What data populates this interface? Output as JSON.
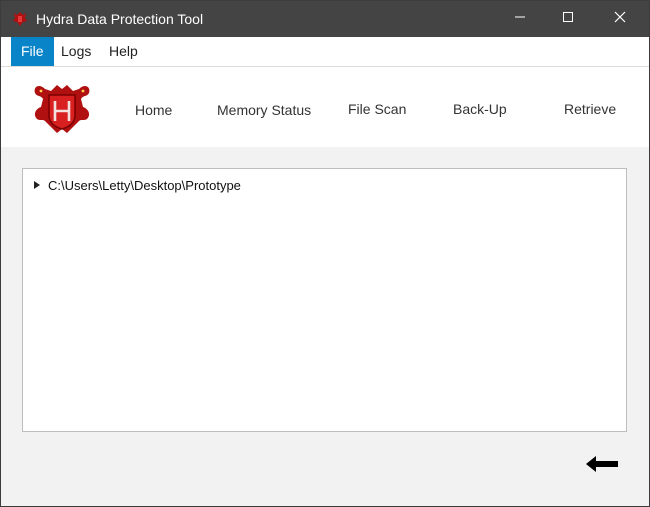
{
  "window": {
    "title": "Hydra Data Protection Tool",
    "icon": "hydra-icon",
    "controls": {
      "minimize": "minimize-icon",
      "maximize": "maximize-icon",
      "close": "close-icon"
    }
  },
  "menu": {
    "items": [
      {
        "label": "File",
        "selected": true
      },
      {
        "label": "Logs",
        "selected": false
      },
      {
        "label": "Help",
        "selected": false
      }
    ]
  },
  "nav": {
    "logo": "hydra-logo",
    "links": [
      "Home",
      "Memory Status",
      "File Scan",
      "Back-Up",
      "Retrieve"
    ]
  },
  "tree": {
    "root": {
      "path": "C:\\Users\\Letty\\Desktop\\Prototype",
      "expanded": false
    }
  },
  "footer": {
    "back_icon": "left-arrow-icon"
  },
  "colors": {
    "titlebar": "#444444",
    "menu_selected": "#0a84c8",
    "logo_red": "#b01010"
  }
}
